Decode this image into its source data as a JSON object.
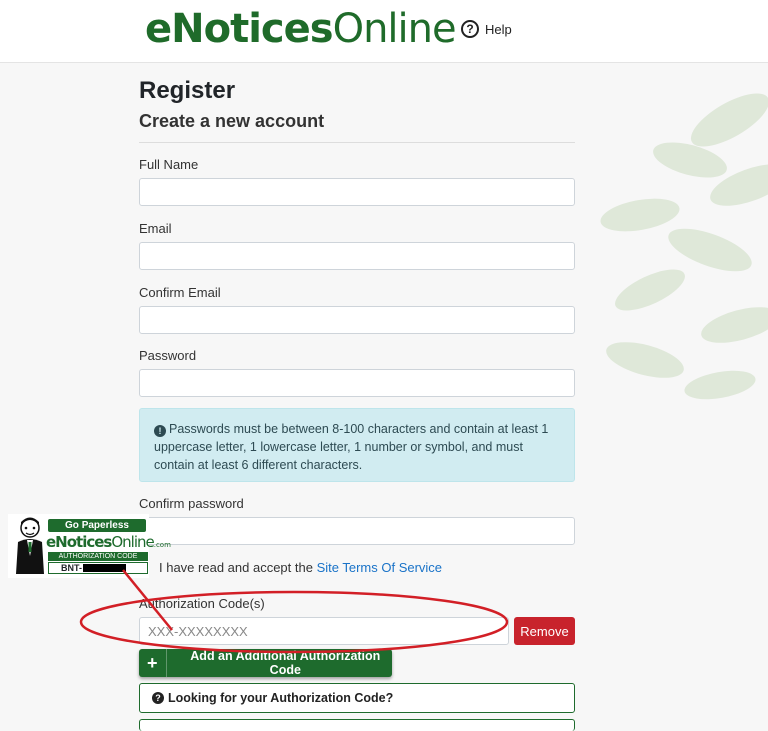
{
  "header": {
    "logo_bold": "eNotices",
    "logo_thin": "Online",
    "help_icon": "question-circle-icon",
    "help_label": "Help"
  },
  "form": {
    "title": "Register",
    "subtitle": "Create a new account",
    "full_name_label": "Full Name",
    "full_name_value": "",
    "email_label": "Email",
    "email_value": "",
    "confirm_email_label": "Confirm Email",
    "confirm_email_value": "",
    "password_label": "Password",
    "password_value": "",
    "password_info": "Passwords must be between 8-100 characters and contain at least 1 uppercase letter, 1 lowercase letter, 1 number or symbol, and must contain at least 6 different characters.",
    "confirm_password_label": "Confirm password",
    "confirm_password_value": "",
    "terms_prefix": "I have read and accept the",
    "terms_link": "Site Terms Of Service",
    "auth_code_label": "Authorization Code(s)",
    "auth_code_placeholder": "XXX-XXXXXXXX",
    "remove_label": "Remove",
    "add_code_label": "Add an Additional Authorization Code",
    "looking_label": "Looking for your Authorization Code?"
  },
  "callout_card": {
    "go_paperless": "Go Paperless",
    "logo_bold": "eNotices",
    "logo_thin": "Online",
    "logo_suffix": ".com",
    "auth_code_caption": "AUTHORIZATION CODE",
    "code_prefix": "BNT-"
  },
  "colors": {
    "brand_green": "#1e6b2d",
    "remove_red": "#c8232c",
    "annotation_red": "#d21f26",
    "info_bg": "#d1ecf1"
  }
}
